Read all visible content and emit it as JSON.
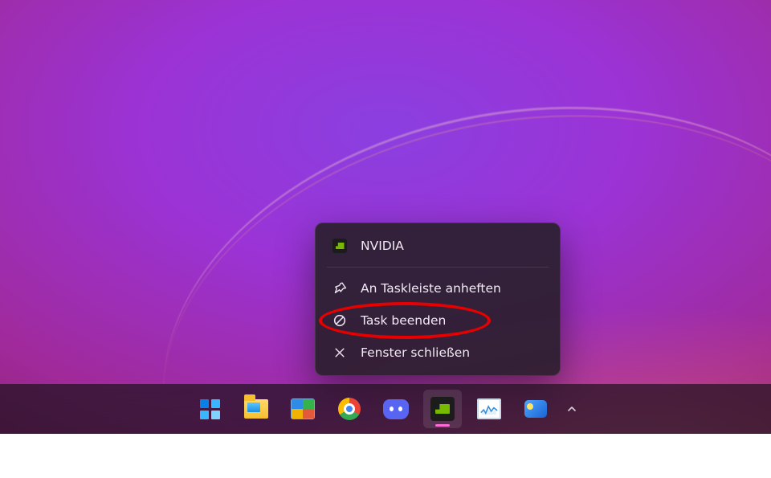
{
  "context_menu": {
    "app_label": "NVIDIA",
    "pin_label": "An Taskleiste anheften",
    "end_task_label": "Task beenden",
    "close_window_label": "Fenster schließen"
  },
  "taskbar": {
    "items": [
      {
        "id": "start",
        "name": "Start",
        "active": false
      },
      {
        "id": "file-explorer",
        "name": "File Explorer",
        "active": false
      },
      {
        "id": "control-panel",
        "name": "Control Panel",
        "active": false
      },
      {
        "id": "chrome",
        "name": "Google Chrome",
        "active": false
      },
      {
        "id": "discord",
        "name": "Discord",
        "active": false
      },
      {
        "id": "nvidia",
        "name": "NVIDIA",
        "active": true
      },
      {
        "id": "task-manager",
        "name": "Task Manager",
        "active": false
      },
      {
        "id": "widgets",
        "name": "Widgets",
        "active": false
      }
    ]
  },
  "annotation": {
    "target": "end-task",
    "color": "#e60000"
  }
}
